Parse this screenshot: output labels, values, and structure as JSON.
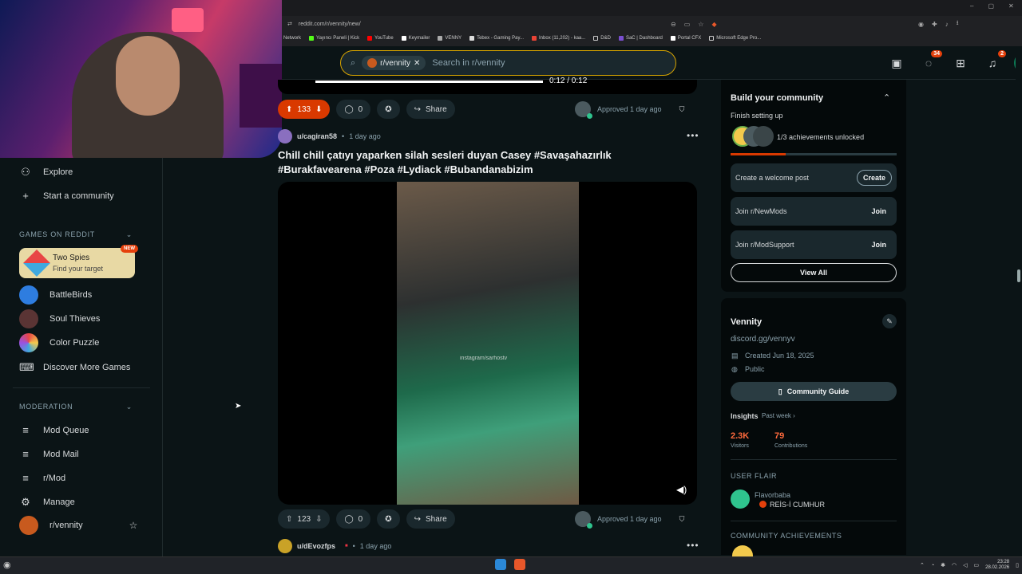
{
  "browser": {
    "url": "reddit.com/r/vennity/new/",
    "bookmarks": [
      "Network",
      "Yayıncı Paneli | Kick",
      "YouTube",
      "Keymailer",
      "VENNY",
      "Tebex - Gaming Pay...",
      "Inbox (11,202) - kaa...",
      "D&D",
      "SaC | Dashboard",
      "Portal CFX",
      "Microsoft Edge Pro..."
    ]
  },
  "header": {
    "sub_chip": "r/vennity",
    "search_placeholder": "Search in r/vennity",
    "chat_badge": "34",
    "notif_badge": "2"
  },
  "sidebar": {
    "explore": "Explore",
    "start_community": "Start a community",
    "games_heading": "GAMES ON REDDIT",
    "featured_game": {
      "title": "Two Spies",
      "subtitle": "Find your target",
      "badge": "NEW"
    },
    "games": [
      "BattleBirds",
      "Soul Thieves",
      "Color Puzzle"
    ],
    "discover": "Discover More Games",
    "moderation_heading": "MODERATION",
    "mod_items": [
      "Mod Queue",
      "Mod Mail",
      "r/Mod",
      "Manage",
      "r/vennity"
    ]
  },
  "feed": {
    "video_time": "0:12 / 0:12",
    "post1": {
      "votes": "133",
      "comments": "0",
      "share": "Share",
      "approved": "Approved 1 day ago"
    },
    "post2": {
      "author": "u/cagiran58",
      "age": "1 day ago",
      "title": "Chill chill çatıyı yaparken silah sesleri duyan Casey #Savaşahazırlık #Burakfavearena #Poza #Lydiack #Bubandanabizim",
      "watermark": "instagram/sarhostv",
      "votes": "123",
      "comments": "0",
      "share": "Share",
      "approved": "Approved 1 day ago"
    },
    "post3": {
      "author": "u/dEvozfps",
      "age": "1 day ago"
    }
  },
  "right": {
    "build_title": "Build your community",
    "build_sub": "Finish setting up",
    "achievements": "1/3 achievements unlocked",
    "achievement_progress": 0.33,
    "tasks": [
      {
        "label": "Create a welcome post",
        "action": "Create"
      },
      {
        "label": "Join r/NewMods",
        "action": "Join"
      },
      {
        "label": "Join r/ModSupport",
        "action": "Join"
      }
    ],
    "view_all": "View All",
    "community_name": "Vennity",
    "discord": "discord.gg/vennyv",
    "created": "Created Jun 18, 2025",
    "visibility": "Public",
    "guide": "Community Guide",
    "insights": "Insights",
    "insights_range": "Past week",
    "visitors_value": "2.3K",
    "visitors_label": "Visitors",
    "contrib_value": "79",
    "contrib_label": "Contributions",
    "user_flair_heading": "USER FLAIR",
    "flair_user": "Flavorbaba",
    "flair_text": "REİS-İ CUMHUR",
    "achievements_heading": "COMMUNITY ACHIEVEMENTS"
  },
  "taskbar": {
    "time": "23:28",
    "date": "28.02.2026"
  },
  "colors": {
    "accent": "#d93900",
    "bg": "#0b1416",
    "search_border": "#d7a400",
    "online": "#2fc48e"
  }
}
